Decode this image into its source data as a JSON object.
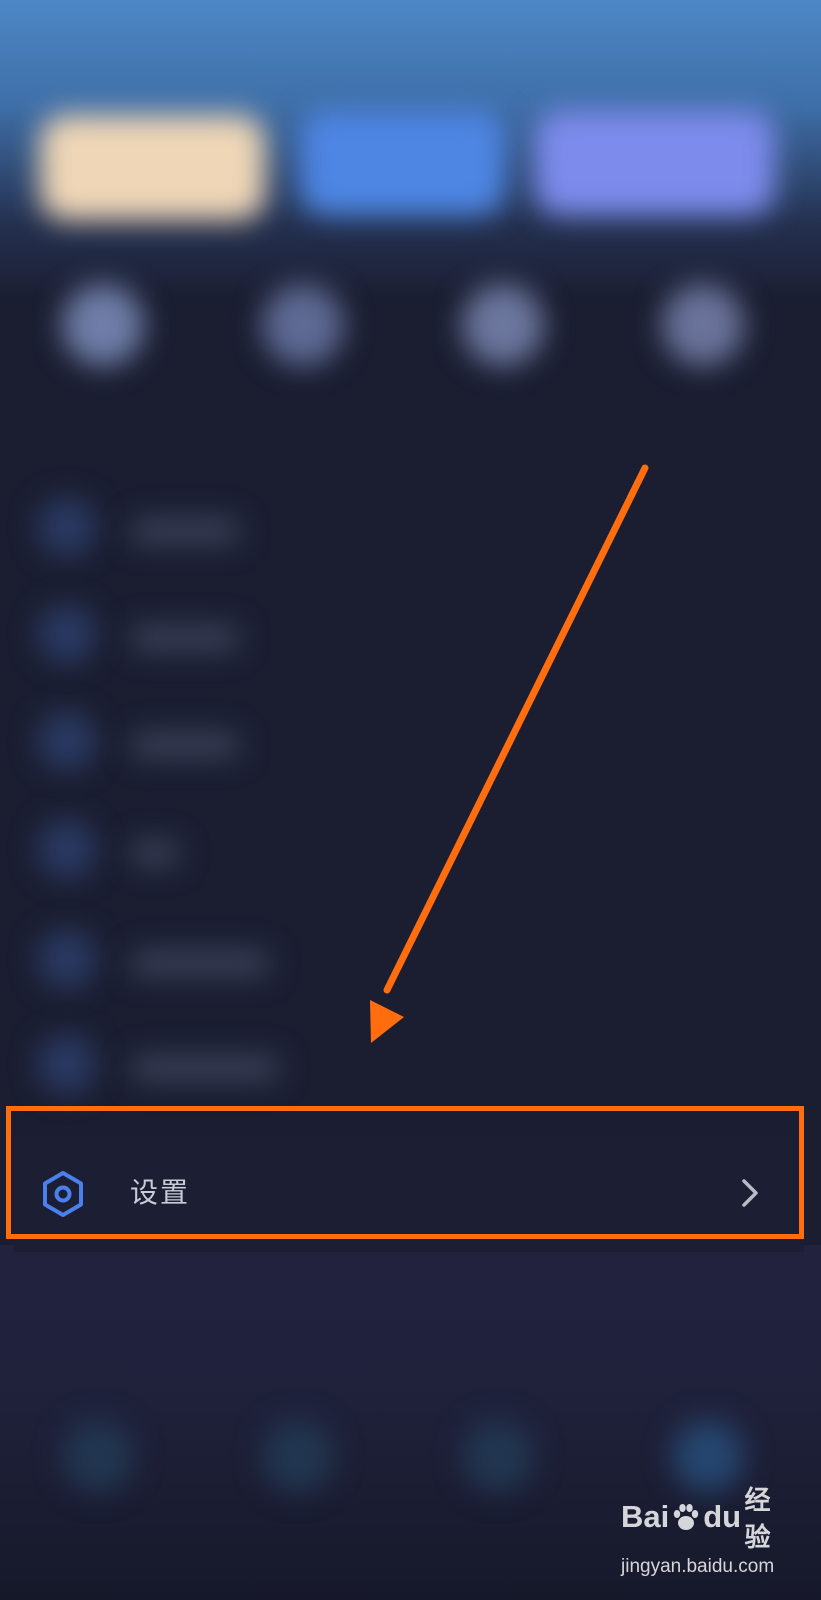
{
  "settings": {
    "label": "设置",
    "icon": "hexagon-settings-icon",
    "chevron_icon": "chevron-right-icon",
    "accent_color": "#4a80ee"
  },
  "annotation": {
    "highlight_color": "#ff6d0f",
    "arrow_color": "#ff6d0f"
  },
  "watermark": {
    "brand_left": "Bai",
    "brand_right": "du",
    "brand_cn": "经验",
    "url": "jingyan.baidu.com"
  }
}
